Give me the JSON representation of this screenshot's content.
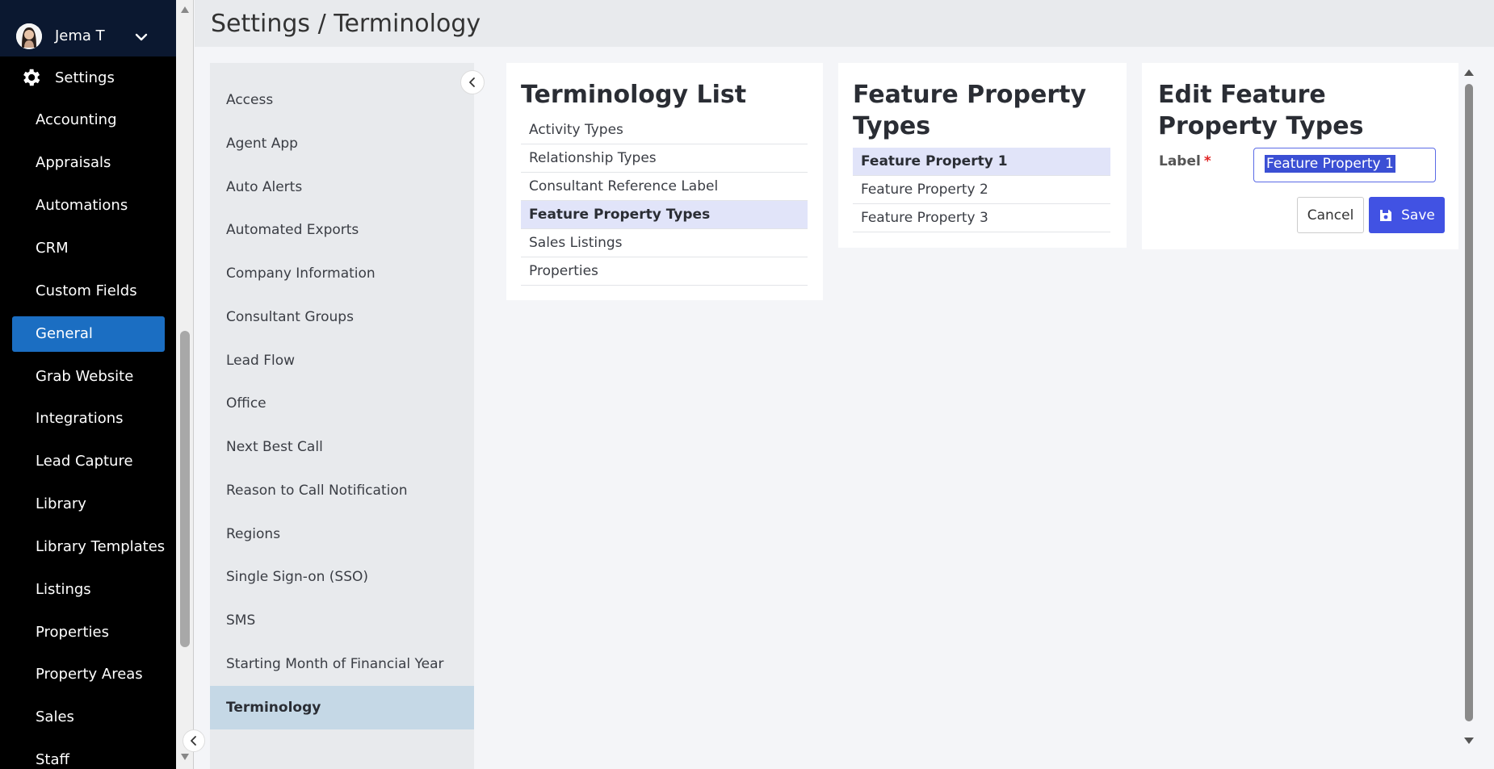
{
  "user": {
    "name": "Jema T"
  },
  "nav": {
    "settings_label": "Settings",
    "items": [
      {
        "label": "Accounting"
      },
      {
        "label": "Appraisals"
      },
      {
        "label": "Automations"
      },
      {
        "label": "CRM"
      },
      {
        "label": "Custom Fields"
      },
      {
        "label": "General"
      },
      {
        "label": "Grab Website"
      },
      {
        "label": "Integrations"
      },
      {
        "label": "Lead Capture"
      },
      {
        "label": "Library"
      },
      {
        "label": "Library Templates"
      },
      {
        "label": "Listings"
      },
      {
        "label": "Properties"
      },
      {
        "label": "Property Areas"
      },
      {
        "label": "Sales"
      },
      {
        "label": "Staff"
      }
    ],
    "active": "General",
    "active_color": "#1b6ec2"
  },
  "header": {
    "title": "Settings / Terminology"
  },
  "submenu": {
    "items": [
      {
        "label": "Access"
      },
      {
        "label": "Agent App"
      },
      {
        "label": "Auto Alerts"
      },
      {
        "label": "Automated Exports"
      },
      {
        "label": "Company Information"
      },
      {
        "label": "Consultant Groups"
      },
      {
        "label": "Lead Flow"
      },
      {
        "label": "Office"
      },
      {
        "label": "Next Best Call"
      },
      {
        "label": "Reason to Call Notification"
      },
      {
        "label": "Regions"
      },
      {
        "label": "Single Sign-on (SSO)"
      },
      {
        "label": "SMS"
      },
      {
        "label": "Starting Month of Financial Year"
      },
      {
        "label": "Terminology"
      }
    ],
    "active": "Terminology"
  },
  "terminology_list": {
    "title": "Terminology List",
    "items": [
      {
        "label": "Activity Types"
      },
      {
        "label": "Relationship Types"
      },
      {
        "label": "Consultant Reference Label"
      },
      {
        "label": "Feature Property Types"
      },
      {
        "label": "Sales Listings"
      },
      {
        "label": "Properties"
      }
    ],
    "active": "Feature Property Types"
  },
  "feature_property_types": {
    "title": "Feature Property Types",
    "items": [
      {
        "label": "Feature Property 1"
      },
      {
        "label": "Feature Property 2"
      },
      {
        "label": "Feature Property 3"
      }
    ],
    "active": "Feature Property 1"
  },
  "edit_panel": {
    "title": "Edit Feature Property Types",
    "label_field": {
      "label": "Label",
      "required_mark": "*",
      "value": "Feature Property 1"
    },
    "cancel_label": "Cancel",
    "save_label": "Save"
  },
  "colors": {
    "primary": "#4152e3",
    "selection_bg": "#e1e4f9",
    "submenu_active_bg": "#c5d8e6"
  }
}
